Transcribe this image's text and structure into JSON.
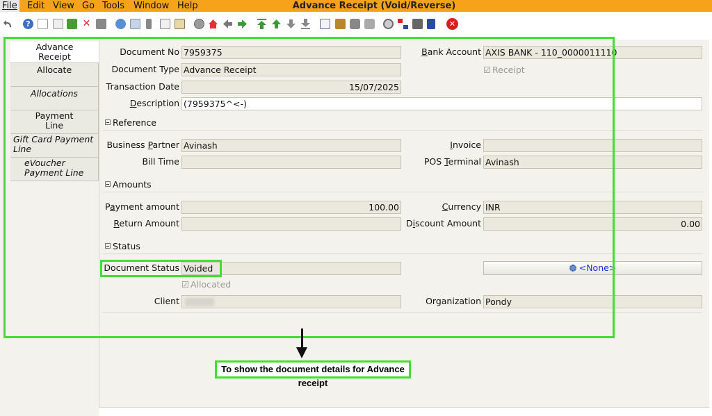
{
  "window": {
    "title": "Advance Receipt (Void/Reverse)"
  },
  "menu": {
    "file": "File",
    "edit": "Edit",
    "view": "View",
    "go": "Go",
    "tools": "Tools",
    "window": "Window",
    "help": "Help"
  },
  "toolbar": {
    "icons": [
      "undo-icon",
      "help-icon",
      "new-icon",
      "copy-icon",
      "save-icon",
      "delete-icon",
      "print-preview-icon",
      "refresh-icon",
      "find-icon",
      "attachment-icon",
      "chat-icon",
      "history-icon",
      "grid-toggle-icon",
      "home-icon",
      "back-icon",
      "forward-icon",
      "first-record-icon",
      "previous-record-icon",
      "next-record-icon",
      "last-record-icon",
      "report-icon",
      "archive-icon",
      "print-icon",
      "print-setup-icon",
      "zoom-across-icon",
      "workflow-icon",
      "request-icon",
      "product-info-icon",
      "close-icon"
    ]
  },
  "tabs": [
    {
      "label": "Advance Receipt"
    },
    {
      "label": "Allocate"
    },
    {
      "label": "Allocations"
    },
    {
      "label": "Payment Line"
    },
    {
      "label": "Gift Card Payment Line"
    },
    {
      "label": "eVoucher Payment Line"
    }
  ],
  "form": {
    "document_no": {
      "label": "Document No",
      "value": "7959375"
    },
    "bank_account": {
      "label": "Bank Account",
      "value": "AXIS BANK - 110_0000011110"
    },
    "document_type": {
      "label": "Document Type",
      "value": "Advance Receipt"
    },
    "receipt": {
      "label": "Receipt",
      "checked": true
    },
    "transaction_date": {
      "label": "Transaction Date",
      "value": "15/07/2025"
    },
    "description": {
      "label": "Description",
      "value": "(7959375^<-)"
    }
  },
  "sections": {
    "reference": "Reference",
    "amounts": "Amounts",
    "status": "Status"
  },
  "reference": {
    "business_partner": {
      "label": "Business Partner",
      "value": "Avinash"
    },
    "invoice": {
      "label": "Invoice",
      "value": ""
    },
    "bill_time": {
      "label": "Bill Time",
      "value": ""
    },
    "pos_terminal": {
      "label": "POS Terminal",
      "value": "Avinash"
    }
  },
  "amounts": {
    "payment_amount": {
      "label": "Payment amount",
      "value": "100.00"
    },
    "currency": {
      "label": "Currency",
      "value": "INR"
    },
    "return_amount": {
      "label": "Return Amount",
      "value": ""
    },
    "discount_amount": {
      "label": "Discount Amount",
      "value": "0.00"
    }
  },
  "status": {
    "document_status": {
      "label": "Document Status",
      "value": "Voided"
    },
    "doc_action": {
      "value": "<None>"
    },
    "allocated": {
      "label": "Allocated",
      "checked": true
    },
    "client": {
      "label": "Client",
      "value": ""
    },
    "organization": {
      "label": "Organization",
      "value": "Pondy"
    }
  },
  "annotation": {
    "caption": "To show the document details for Advance receipt",
    "color": "#44dd33"
  }
}
